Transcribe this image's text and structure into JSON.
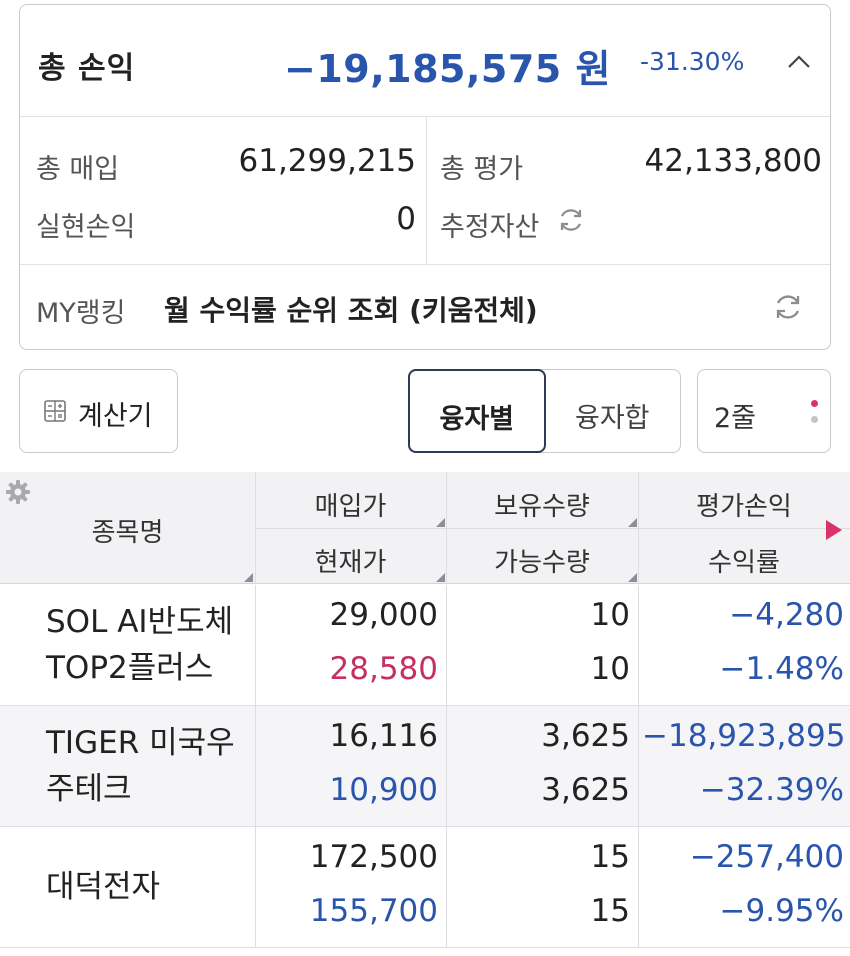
{
  "summary": {
    "total_pnl_label": "총 손익",
    "total_pnl_value": "−19,185,575",
    "total_pnl_unit": "원",
    "total_pnl_rate": "-31.30%",
    "total_buy_label": "총 매입",
    "total_buy_value": "61,299,215",
    "total_eval_label": "총 평가",
    "total_eval_value": "42,133,800",
    "realized_label": "실현손익",
    "realized_value": "0",
    "estimated_assets_label": "추정자산",
    "ranking_label": "MY랭킹",
    "ranking_text": "월 수익률 순위 조회 (키움전체)"
  },
  "toolbar": {
    "calculator_label": "계산기",
    "segment_active_label": "융자별",
    "segment_other_label": "융자합",
    "lines_label": "2줄"
  },
  "table": {
    "headers": {
      "name": "종목명",
      "buy_price": "매입가",
      "current_price": "현재가",
      "holding_qty": "보유수량",
      "available_qty": "가능수량",
      "eval_pnl": "평가손익",
      "return_rate": "수익률"
    },
    "rows": [
      {
        "name_line1": "SOL AI반도체",
        "name_line2": "TOP2플러스",
        "buy_price": "29,000",
        "current_price": "28,580",
        "holding_qty": "10",
        "available_qty": "10",
        "eval_pnl": "−4,280",
        "return_rate": "−1.48%"
      },
      {
        "name_line1": "TIGER 미국우",
        "name_line2": "주테크",
        "buy_price": "16,116",
        "current_price": "10,900",
        "holding_qty": "3,625",
        "available_qty": "3,625",
        "eval_pnl": "−18,923,895",
        "return_rate": "−32.39%"
      },
      {
        "name_line1": "대덕전자",
        "name_line2": "",
        "buy_price": "172,500",
        "current_price": "155,700",
        "holding_qty": "15",
        "available_qty": "15",
        "eval_pnl": "−257,400",
        "return_rate": "−9.95%"
      }
    ]
  },
  "colors": {
    "negative_blue": "#2a55ad",
    "rise_red": "#c43063",
    "active_border": "#2d3a55",
    "accent_pink": "#d9336a"
  },
  "icons": [
    "chevron-up-icon",
    "refresh-icon",
    "calculator-icon",
    "more-dots-icon",
    "gear-icon",
    "sort-triangle-icon",
    "scroll-right-icon"
  ]
}
